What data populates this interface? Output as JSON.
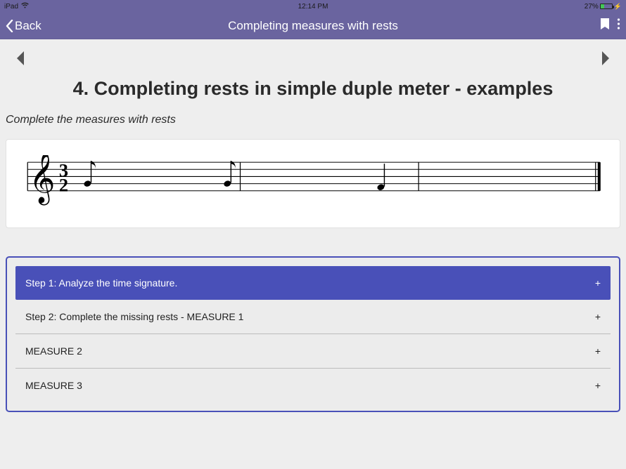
{
  "status": {
    "device": "iPad",
    "time": "12:14 PM",
    "battery_pct": "27%"
  },
  "nav": {
    "back_label": "Back",
    "title": "Completing measures with rests"
  },
  "page": {
    "heading": "4. Completing rests in simple duple meter - examples",
    "instruction": "Complete the measures with rests"
  },
  "notation": {
    "time_signature": "3/2",
    "measures": 3
  },
  "accordion": [
    {
      "label": "Step 1: Analyze the time signature.",
      "active": true,
      "plus": "+"
    },
    {
      "label": "Step 2: Complete the missing rests - MEASURE 1",
      "active": false,
      "plus": "+"
    },
    {
      "label": "MEASURE 2",
      "active": false,
      "plus": "+"
    },
    {
      "label": "MEASURE 3",
      "active": false,
      "plus": "+"
    }
  ]
}
